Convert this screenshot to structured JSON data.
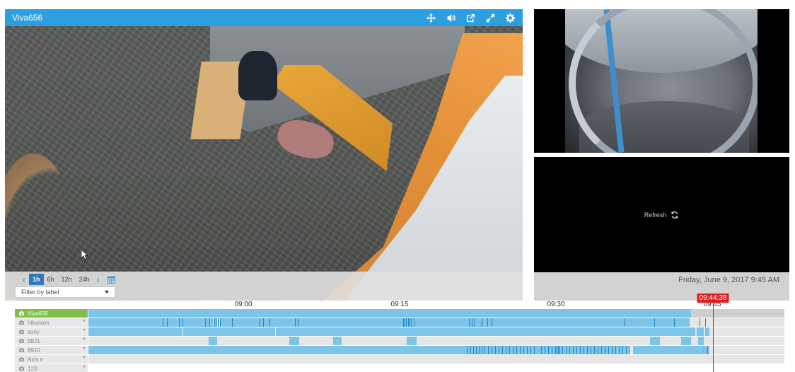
{
  "main_camera": {
    "title": "Viva656",
    "header_icons": [
      "move-icon",
      "volume-icon",
      "external-link-icon",
      "expand-icon",
      "gear-icon"
    ],
    "accent": "#2d9fe0"
  },
  "playback": {
    "prev": "‹",
    "next": "›",
    "ranges": [
      "1h",
      "6h",
      "12h",
      "24h"
    ],
    "active_range": "1h",
    "filter_placeholder": "Filter by label"
  },
  "refresh_label": "Refresh",
  "date_display": "Friday, June 9, 2017 9:45 AM",
  "timeline": {
    "ticks": [
      "09:00",
      "09:15",
      "09:30",
      "09:45"
    ],
    "current_time": "09:44:38",
    "rows": [
      {
        "label": "Viva656",
        "active": true
      },
      {
        "label": "hikvision",
        "active": false
      },
      {
        "label": "sony",
        "active": false
      },
      {
        "label": "9821",
        "active": false
      },
      {
        "label": "8910",
        "active": false
      },
      {
        "label": "Axis e",
        "active": false
      },
      {
        "label": "123",
        "active": false
      }
    ]
  }
}
